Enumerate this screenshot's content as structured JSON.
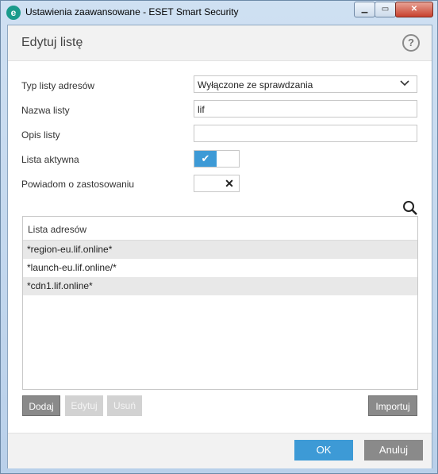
{
  "window": {
    "title": "Ustawienia zaawansowane - ESET Smart Security",
    "app_icon_letter": "e",
    "controls": {
      "minimize": "▁",
      "maximize": "▭",
      "close": "✕"
    }
  },
  "header": {
    "title": "Edytuj listę",
    "help_label": "?"
  },
  "form": {
    "list_type": {
      "label": "Typ listy adresów",
      "value": "Wyłączone ze sprawdzania"
    },
    "list_name": {
      "label": "Nazwa listy",
      "value": "lif"
    },
    "list_description": {
      "label": "Opis listy",
      "value": ""
    },
    "list_active": {
      "label": "Lista aktywna",
      "state": true,
      "glyph": "✔"
    },
    "notify_on_apply": {
      "label": "Powiadom o zastosowaniu",
      "state": false,
      "glyph": "✕"
    }
  },
  "address_list": {
    "header": "Lista adresów",
    "rows": [
      "*region-eu.lif.online*",
      "*launch-eu.lif.online/*",
      "*cdn1.lif.online*"
    ]
  },
  "list_buttons": {
    "add": "Dodaj",
    "edit": "Edytuj",
    "remove": "Usuń",
    "import": "Importuj"
  },
  "footer": {
    "ok": "OK",
    "cancel": "Anuluj"
  },
  "colors": {
    "accent": "#3d9ad6",
    "button_gray": "#8a8a8a",
    "row_alt": "#e8e8e8",
    "eset_teal": "#1a9b8b"
  }
}
